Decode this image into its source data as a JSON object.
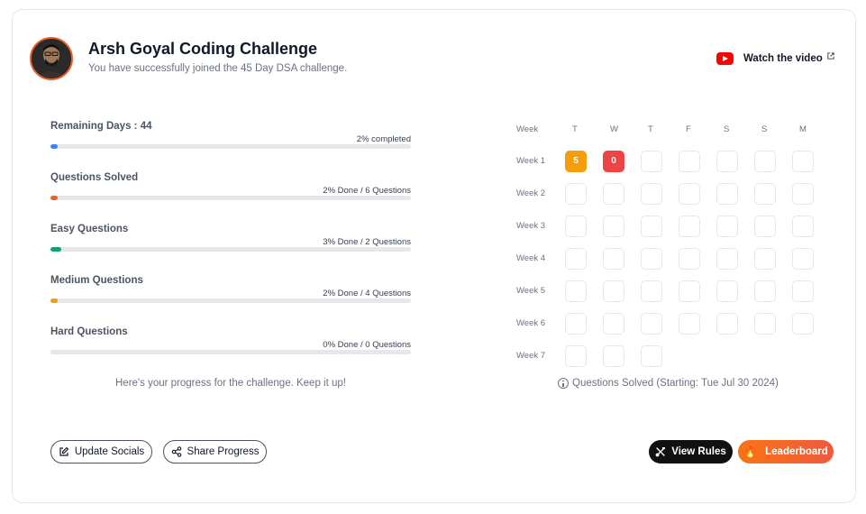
{
  "header": {
    "title": "Arsh Goyal Coding Challenge",
    "subtitle": "You have successfully joined the 45 Day DSA challenge.",
    "watch_label": "Watch the video"
  },
  "progress": [
    {
      "label": "Remaining Days : 44",
      "meta": "2% completed",
      "percent": 2,
      "color": "#3b82f6"
    },
    {
      "label": "Questions Solved",
      "meta": "2% Done / 6 Questions",
      "percent": 2,
      "color": "#e8612c"
    },
    {
      "label": "Easy Questions",
      "meta": "3% Done / 2 Questions",
      "percent": 3,
      "color": "#10a36b"
    },
    {
      "label": "Medium Questions",
      "meta": "2% Done / 4 Questions",
      "percent": 2,
      "color": "#f59e0b"
    },
    {
      "label": "Hard Questions",
      "meta": "0% Done / 0 Questions",
      "percent": 0,
      "color": "#ef4444"
    }
  ],
  "encouragement": "Here's your progress for the challenge. Keep it up!",
  "calendar": {
    "week_header": "Week",
    "days": [
      "T",
      "W",
      "T",
      "F",
      "S",
      "S",
      "M"
    ],
    "weeks": [
      {
        "label": "Week 1",
        "cells": [
          "5",
          "0",
          "",
          "",
          "",
          "",
          ""
        ]
      },
      {
        "label": "Week 2",
        "cells": [
          "",
          "",
          "",
          "",
          "",
          "",
          ""
        ]
      },
      {
        "label": "Week 3",
        "cells": [
          "",
          "",
          "",
          "",
          "",
          "",
          ""
        ]
      },
      {
        "label": "Week 4",
        "cells": [
          "",
          "",
          "",
          "",
          "",
          "",
          ""
        ]
      },
      {
        "label": "Week 5",
        "cells": [
          "",
          "",
          "",
          "",
          "",
          "",
          ""
        ]
      },
      {
        "label": "Week 6",
        "cells": [
          "",
          "",
          "",
          "",
          "",
          "",
          ""
        ]
      },
      {
        "label": "Week 7",
        "cells": [
          "",
          "",
          ""
        ]
      }
    ],
    "caption": "Questions Solved (Starting: Tue Jul 30 2024)"
  },
  "buttons": {
    "update_socials": "Update Socials",
    "share_progress": "Share Progress",
    "view_rules": "View Rules",
    "leaderboard": "Leaderboard"
  },
  "colors": {
    "accent": "#e8612c",
    "orange_cell": "#f59e0b",
    "red_cell": "#ef4444"
  }
}
